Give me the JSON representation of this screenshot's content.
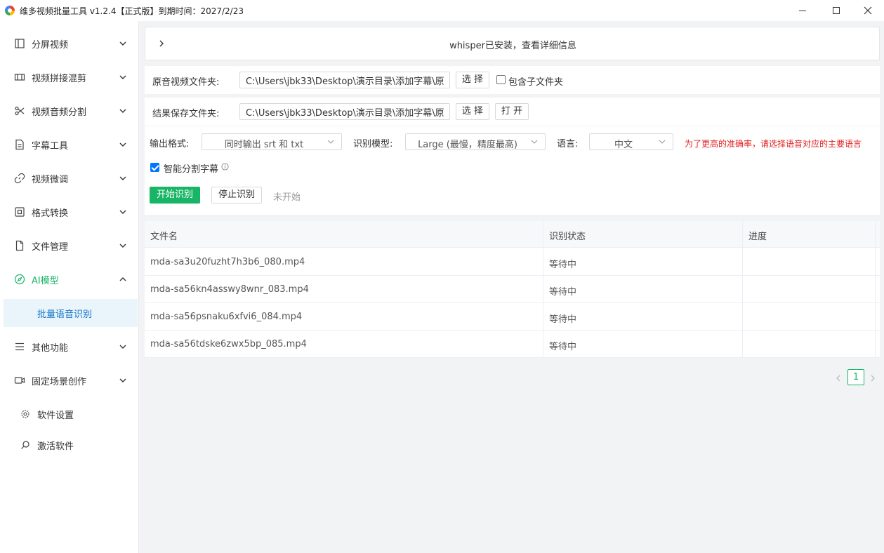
{
  "window": {
    "title": "维多视频批量工具 v1.2.4【正式版】到期时间：2027/2/23"
  },
  "sidebar": {
    "items": [
      {
        "label": "分屏视频",
        "icon": "layout-icon"
      },
      {
        "label": "视频拼接混剪",
        "icon": "film-icon"
      },
      {
        "label": "视频音频分割",
        "icon": "scissors-icon"
      },
      {
        "label": "字幕工具",
        "icon": "document-icon"
      },
      {
        "label": "视频微调",
        "icon": "link-icon"
      },
      {
        "label": "格式转换",
        "icon": "convert-icon"
      },
      {
        "label": "文件管理",
        "icon": "file-icon"
      },
      {
        "label": "AI模型",
        "icon": "compass-icon",
        "expanded": true
      },
      {
        "label": "其他功能",
        "icon": "menu-icon"
      },
      {
        "label": "固定场景创作",
        "icon": "video-icon"
      }
    ],
    "sub_item": "批量语音识别",
    "settings_label": "软件设置",
    "activate_label": "激活软件",
    "active_color": "#18b566"
  },
  "banner": {
    "text": "whisper已安装，查看详细信息"
  },
  "source": {
    "label": "原音视频文件夹:",
    "path": "C:\\Users\\jbk33\\Desktop\\演示目录\\添加字幕\\原",
    "select_label": "选 择",
    "subfolder_label": "包含子文件夹",
    "subfolder_checked": false
  },
  "output": {
    "label": "结果保存文件夹:",
    "path": "C:\\Users\\jbk33\\Desktop\\演示目录\\添加字幕\\原",
    "select_label": "选 择",
    "open_label": "打 开"
  },
  "settings": {
    "format_label": "输出格式:",
    "format_value": "同时输出 srt 和 txt",
    "model_label": "识别模型:",
    "model_value": "Large (最慢，精度最高)",
    "language_label": "语言:",
    "language_value": "中文",
    "warning": "为了更高的准确率，请选择语音对应的主要语言",
    "smart_split_label": "智能分割字幕",
    "smart_split_checked": true,
    "start_label": "开始识别",
    "stop_label": "停止识别",
    "status": "未开始"
  },
  "table": {
    "columns": [
      "文件名",
      "识别状态",
      "进度"
    ],
    "rows": [
      {
        "file": "mda-sa3u20fuzht7h3b6_080.mp4",
        "status": "等待中",
        "progress": ""
      },
      {
        "file": "mda-sa56kn4asswy8wnr_083.mp4",
        "status": "等待中",
        "progress": ""
      },
      {
        "file": "mda-sa56psnaku6xfvi6_084.mp4",
        "status": "等待中",
        "progress": ""
      },
      {
        "file": "mda-sa56tdske6zwx5bp_085.mp4",
        "status": "等待中",
        "progress": ""
      }
    ]
  },
  "pagination": {
    "current_page": "1"
  },
  "colors": {
    "accent": "#18b566",
    "warning": "#e02020",
    "selected_bg": "#e9f4fb",
    "selected_text": "#1677c9"
  }
}
